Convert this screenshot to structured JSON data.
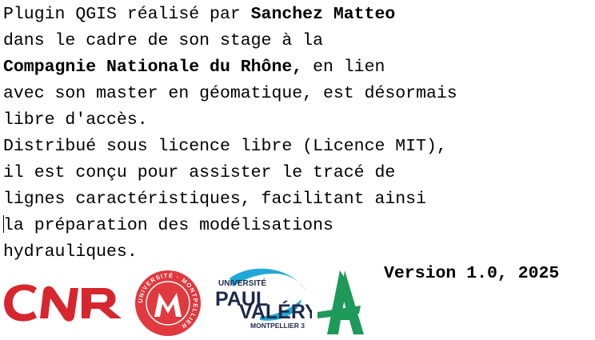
{
  "about": {
    "line1_prefix": "Plugin QGIS réalisé par ",
    "author": "Sanchez Matteo",
    "line2": "dans le cadre de son stage à la",
    "company": "Compagnie Nationale du Rhône,",
    "line3_suffix": " en lien",
    "line4": "avec son master en géomatique, est désormais",
    "line5": "libre d'accès.",
    "line6": "Distribué sous licence libre (Licence MIT),",
    "line7": "il est conçu pour assister le tracé de",
    "line8": "lignes caractéristiques, facilitant ainsi",
    "line9": "la préparation des modélisations",
    "line10": "hydrauliques."
  },
  "version_label": "Version 1.0, 2025",
  "logos": {
    "cnr": {
      "icon": "cnr-logo",
      "color": "#d7262e"
    },
    "montpellier": {
      "icon": "universite-montpellier-logo",
      "color": "#e0393e",
      "text": "UNIVERSITÉ · MONTPELLIER"
    },
    "paul_valery": {
      "icon": "paul-valery-logo",
      "line1": "UNIVERSITÉ",
      "line2": "PAUL",
      "line3": "VALÉRY",
      "line4": "MONTPELLIER 3",
      "color_dark": "#1d2a4a",
      "color_accent": "#1fa8d8"
    },
    "a_logo": {
      "icon": "green-a-logo",
      "color": "#1d9a5a"
    }
  }
}
